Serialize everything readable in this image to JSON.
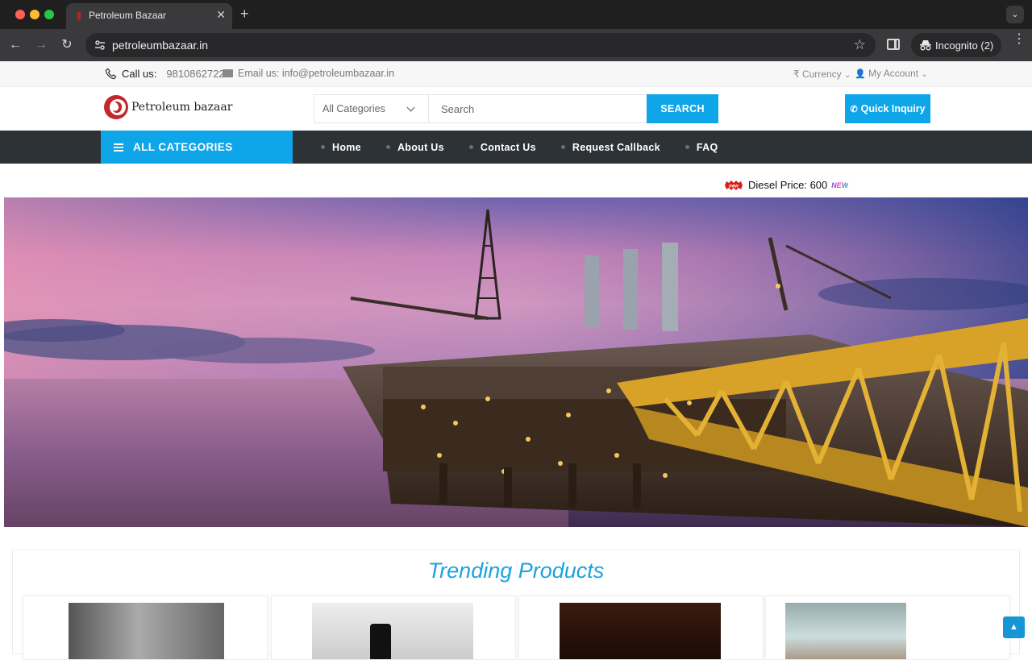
{
  "browser": {
    "tab_title": "Petroleum Bazaar",
    "url": "petroleumbazaar.in",
    "profile_label": "Incognito (2)"
  },
  "topbar": {
    "call_label": "Call us:",
    "phone": "9810862722",
    "email": "Email us: info@petroleumbazaar.in",
    "currency": "₹ Currency",
    "account": "My Account"
  },
  "header": {
    "logo_text": "Petroleum bazaar",
    "category_select": "All Categories",
    "search_placeholder": "Search",
    "search_button": "SEARCH",
    "quick_inquiry": "Quick Inquiry"
  },
  "nav": {
    "all_categories": "ALL CATEGORIES",
    "items": [
      {
        "label": "Home"
      },
      {
        "label": "About Us"
      },
      {
        "label": "Contact Us"
      },
      {
        "label": "Request Callback"
      },
      {
        "label": "FAQ"
      }
    ]
  },
  "ticker": {
    "text": "Diesel Price: 600",
    "badge_new": "new",
    "new_label": "NEW"
  },
  "trending": {
    "title": "Trending Products"
  },
  "colors": {
    "accent": "#0ea5e9",
    "nav_bg": "#2d3236",
    "trending_title": "#1ca3dd"
  },
  "icons": {
    "back_to_top": "chevron-up-icon"
  }
}
